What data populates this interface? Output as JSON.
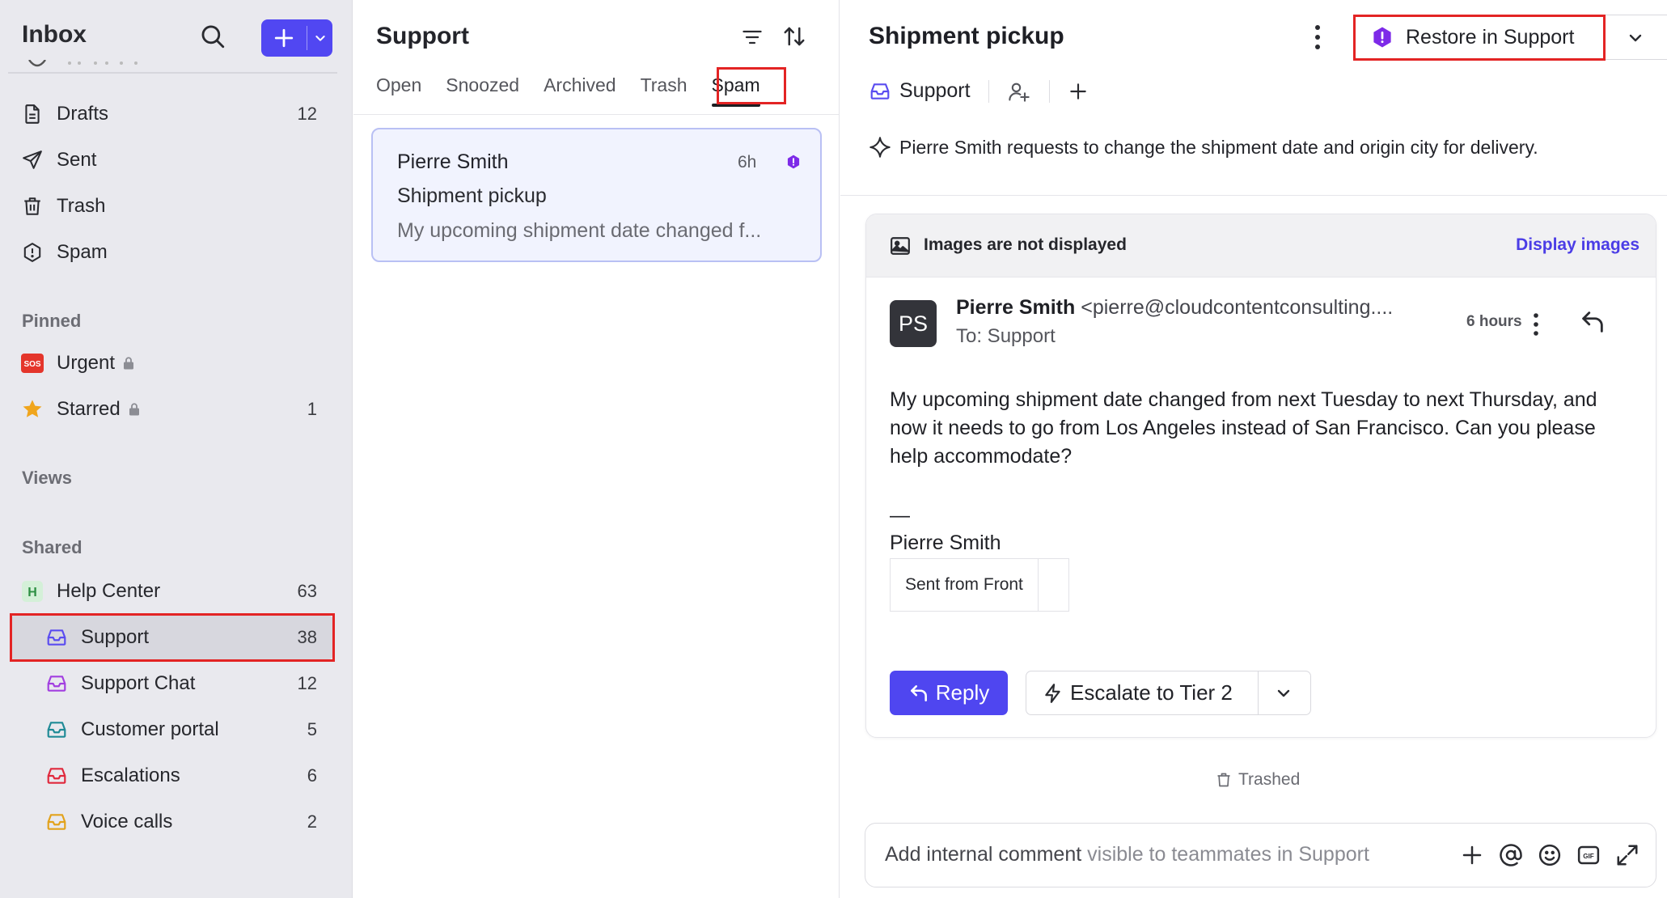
{
  "sidebar": {
    "title": "Inbox",
    "items": [
      {
        "label": "Drafts",
        "count": "12",
        "icon": "draft-icon"
      },
      {
        "label": "Sent",
        "count": "",
        "icon": "send-icon"
      },
      {
        "label": "Trash",
        "count": "",
        "icon": "trash-icon"
      },
      {
        "label": "Spam",
        "count": "",
        "icon": "spam-icon"
      }
    ],
    "pinned_header": "Pinned",
    "pinned": [
      {
        "label": "Urgent",
        "count": "",
        "icon": "sos-icon",
        "emoji": "SOS"
      },
      {
        "label": "Starred",
        "count": "1",
        "icon": "star-icon"
      }
    ],
    "views_header": "Views",
    "shared_header": "Shared",
    "shared": [
      {
        "label": "Help Center",
        "count": "63",
        "icon": "team-h-icon",
        "badge": "H"
      },
      {
        "label": "Support",
        "count": "38",
        "icon": "inbox-tray-icon",
        "color": "#5a4cf0"
      },
      {
        "label": "Support Chat",
        "count": "12",
        "icon": "inbox-tray-icon",
        "color": "#a23fe0"
      },
      {
        "label": "Customer portal",
        "count": "5",
        "icon": "inbox-tray-icon",
        "color": "#1f8a96"
      },
      {
        "label": "Escalations",
        "count": "6",
        "icon": "inbox-tray-icon",
        "color": "#e0283c"
      },
      {
        "label": "Voice calls",
        "count": "2",
        "icon": "inbox-tray-icon",
        "color": "#e2a21b"
      }
    ]
  },
  "list": {
    "title": "Support",
    "tabs": [
      "Open",
      "Snoozed",
      "Archived",
      "Trash",
      "Spam"
    ],
    "active_tab": "Spam",
    "conversations": [
      {
        "from": "Pierre Smith",
        "time": "6h",
        "subject": "Shipment pickup",
        "preview": "My upcoming shipment date changed f..."
      }
    ]
  },
  "detail": {
    "title": "Shipment pickup",
    "restore_label": "Restore in Support",
    "inbox_chip": "Support",
    "summary": "Pierre Smith requests to change the shipment date and origin city for delivery.",
    "images_notice": "Images are not displayed",
    "display_images": "Display images",
    "message": {
      "avatar": "PS",
      "sender_name": "Pierre Smith",
      "sender_email": "<pierre@cloudcontentconsulting....",
      "to": "To: Support",
      "time": "6 hours",
      "body": "My upcoming shipment date changed from next Tuesday to next Thursday, and now it needs to go from Los Angeles instead of San Francisco. Can you please help accommodate?",
      "sig_dash": "—",
      "sig_name": "Pierre Smith",
      "sent_from": "Sent from Front"
    },
    "reply_label": "Reply",
    "escalate_label": "Escalate to Tier 2",
    "trashed_label": "Trashed",
    "comment_placeholder_main": "Add internal comment",
    "comment_placeholder_soft": " visible to teammates in Support"
  },
  "colors": {
    "accent": "#5147f2",
    "highlight": "#e32424",
    "spam_flag": "#7d2ae8"
  }
}
